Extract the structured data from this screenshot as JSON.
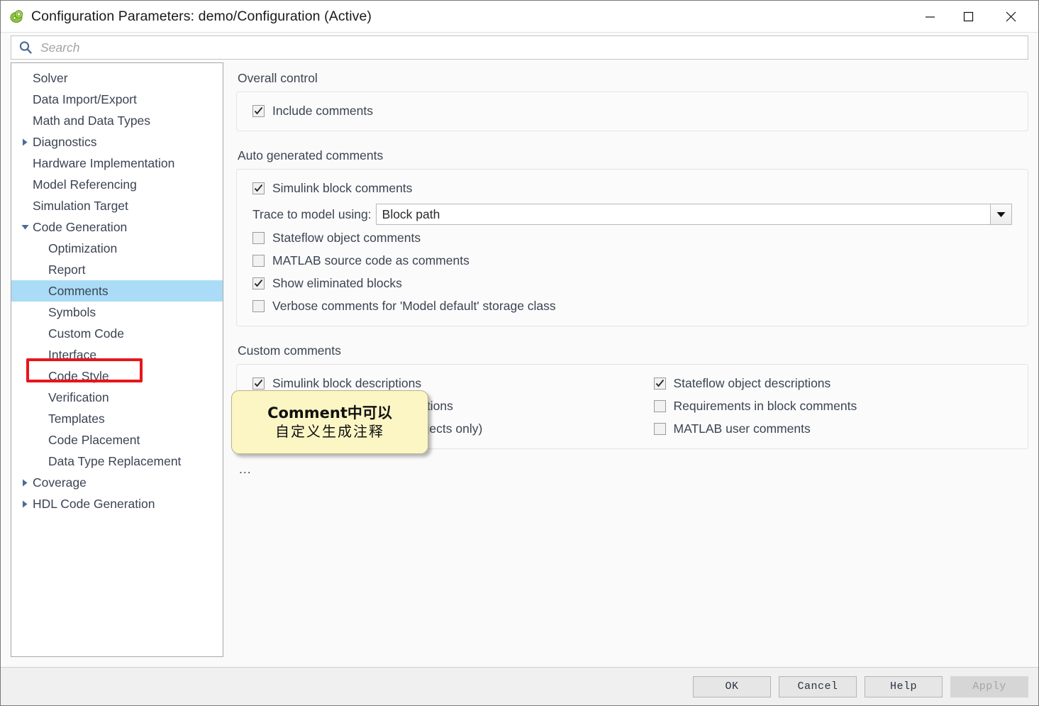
{
  "window": {
    "title": "Configuration Parameters: demo/Configuration (Active)",
    "app_icon": "simulink-icon",
    "minimize_label": "minimize-icon",
    "maximize_label": "maximize-icon",
    "close_label": "close-icon"
  },
  "search": {
    "placeholder": "Search",
    "value": "",
    "icon": "search-icon"
  },
  "tree": {
    "items": [
      {
        "label": "Solver",
        "level": 0,
        "arrow": "none",
        "selected": false
      },
      {
        "label": "Data Import/Export",
        "level": 0,
        "arrow": "none",
        "selected": false
      },
      {
        "label": "Math and Data Types",
        "level": 0,
        "arrow": "none",
        "selected": false
      },
      {
        "label": "Diagnostics",
        "level": 0,
        "arrow": "collapsed",
        "selected": false
      },
      {
        "label": "Hardware Implementation",
        "level": 0,
        "arrow": "none",
        "selected": false
      },
      {
        "label": "Model Referencing",
        "level": 0,
        "arrow": "none",
        "selected": false
      },
      {
        "label": "Simulation Target",
        "level": 0,
        "arrow": "none",
        "selected": false
      },
      {
        "label": "Code Generation",
        "level": 0,
        "arrow": "expanded",
        "selected": false
      },
      {
        "label": "Optimization",
        "level": 1,
        "arrow": "none",
        "selected": false
      },
      {
        "label": "Report",
        "level": 1,
        "arrow": "none",
        "selected": false
      },
      {
        "label": "Comments",
        "level": 1,
        "arrow": "none",
        "selected": true
      },
      {
        "label": "Symbols",
        "level": 1,
        "arrow": "none",
        "selected": false
      },
      {
        "label": "Custom Code",
        "level": 1,
        "arrow": "none",
        "selected": false
      },
      {
        "label": "Interface",
        "level": 1,
        "arrow": "none",
        "selected": false
      },
      {
        "label": "Code Style",
        "level": 1,
        "arrow": "none",
        "selected": false
      },
      {
        "label": "Verification",
        "level": 1,
        "arrow": "none",
        "selected": false
      },
      {
        "label": "Templates",
        "level": 1,
        "arrow": "none",
        "selected": false
      },
      {
        "label": "Code Placement",
        "level": 1,
        "arrow": "none",
        "selected": false
      },
      {
        "label": "Data Type Replacement",
        "level": 1,
        "arrow": "none",
        "selected": false
      },
      {
        "label": "Coverage",
        "level": 0,
        "arrow": "collapsed",
        "selected": false
      },
      {
        "label": "HDL Code Generation",
        "level": 0,
        "arrow": "collapsed",
        "selected": false
      }
    ]
  },
  "content": {
    "overall_control": {
      "title": "Overall control",
      "include_comments": {
        "label": "Include comments",
        "checked": true
      }
    },
    "auto_generated": {
      "title": "Auto generated comments",
      "simulink_block_comments": {
        "label": "Simulink block comments",
        "checked": true
      },
      "trace_label": "Trace to model using:",
      "trace_value": "Block path",
      "stateflow_object_comments": {
        "label": "Stateflow object comments",
        "checked": false
      },
      "matlab_source_code": {
        "label": "MATLAB source code as comments",
        "checked": false
      },
      "show_eliminated_blocks": {
        "label": "Show eliminated blocks",
        "checked": true
      },
      "model_default_storage": {
        "label": "Verbose comments for 'Model default' storage class",
        "visible_text": "Model default' storage class",
        "checked": false
      }
    },
    "custom_comments": {
      "title": "Custom comments",
      "left": [
        {
          "label": "Simulink block descriptions",
          "checked": true
        },
        {
          "label": "Simulink data object descriptions",
          "checked": true
        },
        {
          "label": "Custom comments (MPT objects only)",
          "checked": false
        }
      ],
      "right": [
        {
          "label": "Stateflow object descriptions",
          "checked": true
        },
        {
          "label": "Requirements in block comments",
          "checked": false
        },
        {
          "label": "MATLAB user comments",
          "checked": false
        }
      ]
    },
    "more_indicator": "..."
  },
  "tooltip": {
    "line1": "Comment中可以",
    "line2": "自定义生成注释"
  },
  "annotation": {
    "highlight_color": "#e8151b",
    "selected_row_color": "#aadcf7"
  },
  "footer": {
    "ok": "OK",
    "cancel": "Cancel",
    "help": "Help",
    "apply": "Apply"
  }
}
